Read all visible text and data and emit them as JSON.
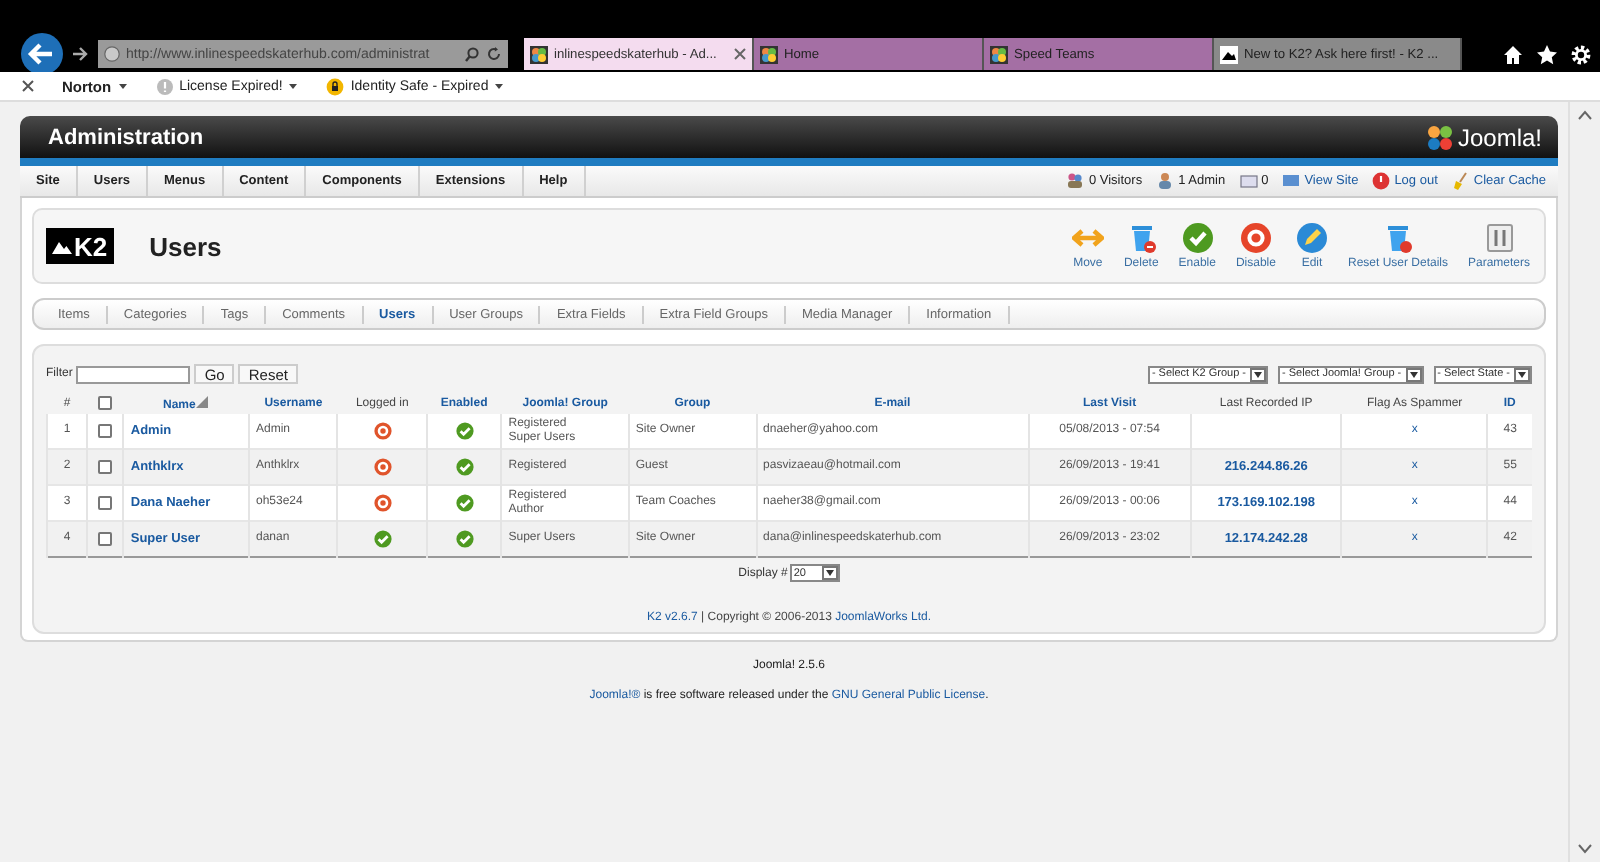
{
  "browser": {
    "address": "http://www.inlinespeedskaterhub.com/administrat",
    "tabs": [
      {
        "label": "inlinespeedskaterhub - Ad...",
        "selected": true,
        "kind": "joomla"
      },
      {
        "label": "Home",
        "selected": false,
        "kind": "joomla"
      },
      {
        "label": "Speed Teams",
        "selected": false,
        "kind": "joomla"
      },
      {
        "label": "New to K2? Ask here first! - K2 ...",
        "selected": false,
        "kind": "k2"
      }
    ]
  },
  "toolbar": {
    "items": [
      {
        "label": "Norton",
        "kind": "norton"
      },
      {
        "label": "License Expired!",
        "kind": "license"
      },
      {
        "label": "Identity Safe - Expired",
        "kind": "identity"
      }
    ]
  },
  "admin": {
    "title": "Administration",
    "logo": "Joomla!",
    "menu": [
      "Site",
      "Users",
      "Menus",
      "Content",
      "Components",
      "Extensions",
      "Help"
    ],
    "status": [
      {
        "label": "0 Visitors",
        "kind": "visitors"
      },
      {
        "label": "1 Admin",
        "kind": "admins"
      },
      {
        "label": "0",
        "kind": "messages"
      },
      {
        "label": "View Site",
        "kind": "site"
      },
      {
        "label": "Log out",
        "kind": "logout"
      },
      {
        "label": "Clear Cache",
        "kind": "cache"
      }
    ]
  },
  "k2": {
    "logo": "K2",
    "title": "Users",
    "actions": [
      {
        "label": "Move",
        "kind": "move"
      },
      {
        "label": "Delete",
        "kind": "delete"
      },
      {
        "label": "Enable",
        "kind": "enable"
      },
      {
        "label": "Disable",
        "kind": "disable"
      },
      {
        "label": "Edit",
        "kind": "edit"
      },
      {
        "label": "Reset User Details",
        "kind": "reset"
      },
      {
        "label": "Parameters",
        "kind": "parameters"
      }
    ],
    "tabs": [
      {
        "label": "Items",
        "selected": false
      },
      {
        "label": "Categories",
        "selected": false
      },
      {
        "label": "Tags",
        "selected": false
      },
      {
        "label": "Comments",
        "selected": false
      },
      {
        "label": "Users",
        "selected": true
      },
      {
        "label": "User Groups",
        "selected": false
      },
      {
        "label": "Extra Fields",
        "selected": false
      },
      {
        "label": "Extra Field Groups",
        "selected": false
      },
      {
        "label": "Media Manager",
        "selected": false
      },
      {
        "label": "Information",
        "selected": false
      }
    ]
  },
  "filter": {
    "label": "Filter",
    "buttons": [
      "Go",
      "Reset"
    ],
    "selects": [
      "- Select K2 Group -",
      "- Select Joomla! Group -",
      "- Select State -"
    ]
  },
  "table": {
    "select_all": {
      "checked": false
    },
    "columns": [
      {
        "label": "#",
        "sortable": false
      },
      {
        "label": "Name",
        "sortable": true
      },
      {
        "label": "Username",
        "sortable": true
      },
      {
        "label": "Logged in",
        "sortable": false
      },
      {
        "label": "Enabled",
        "sortable": true
      },
      {
        "label": "Joomla! Group",
        "sortable": true
      },
      {
        "label": "Group",
        "sortable": true
      },
      {
        "label": "E-mail",
        "sortable": true
      },
      {
        "label": "Last Visit",
        "sortable": true
      },
      {
        "label": "Last Recorded IP",
        "sortable": false
      },
      {
        "label": "Flag As Spammer",
        "sortable": false
      },
      {
        "label": "ID",
        "sortable": true
      }
    ],
    "rows": [
      {
        "num": "1",
        "checked": false,
        "name": "Admin",
        "username": "Admin",
        "logged_in": false,
        "enabled": true,
        "joomla_group": [
          "Registered",
          "Super Users"
        ],
        "group": "Site Owner",
        "email": "dnaeher@yahoo.com",
        "last_visit": "05/08/2013 - 07:54",
        "flag": "x",
        "id": "43"
      },
      {
        "num": "2",
        "checked": false,
        "name": "Anthklrx",
        "username": "Anthklrx",
        "logged_in": false,
        "enabled": true,
        "joomla_group": [
          "Registered"
        ],
        "group": "Guest",
        "email": "pasvizaeau@hotmail.com",
        "last_visit": "26/09/2013 - 19:41",
        "ip": "216.244.86.26",
        "flag": "x",
        "id": "55"
      },
      {
        "num": "3",
        "checked": false,
        "name": "Dana Naeher",
        "username": "oh53e24",
        "logged_in": false,
        "enabled": true,
        "joomla_group": [
          "Registered",
          "Author"
        ],
        "group": "Team Coaches",
        "email": "naeher38@gmail.com",
        "last_visit": "26/09/2013 - 00:06",
        "ip": "173.169.102.198",
        "flag": "x",
        "id": "44"
      },
      {
        "num": "4",
        "checked": false,
        "name": "Super User",
        "username": "danan",
        "logged_in": true,
        "enabled": true,
        "joomla_group": [
          "Super Users"
        ],
        "group": "Site Owner",
        "email": "dana@inlinespeedskaterhub.com",
        "last_visit": "26/09/2013 - 23:02",
        "ip": "12.174.242.28",
        "flag": "x",
        "id": "42"
      }
    ],
    "display": {
      "label": "Display #",
      "value": "20"
    }
  },
  "k2_footer": [
    {
      "text": "K2 v2.6.7",
      "link": true
    },
    {
      "text": " | Copyright © 2006-2013 ",
      "link": false
    },
    {
      "text": "JoomlaWorks Ltd.",
      "link": true
    }
  ],
  "version": "Joomla! 2.5.6",
  "license": [
    {
      "text": "Joomla!®",
      "link": true
    },
    {
      "text": " is free software released under the ",
      "link": false
    },
    {
      "text": "GNU General Public License",
      "link": true
    },
    {
      "text": ".",
      "link": false
    }
  ]
}
